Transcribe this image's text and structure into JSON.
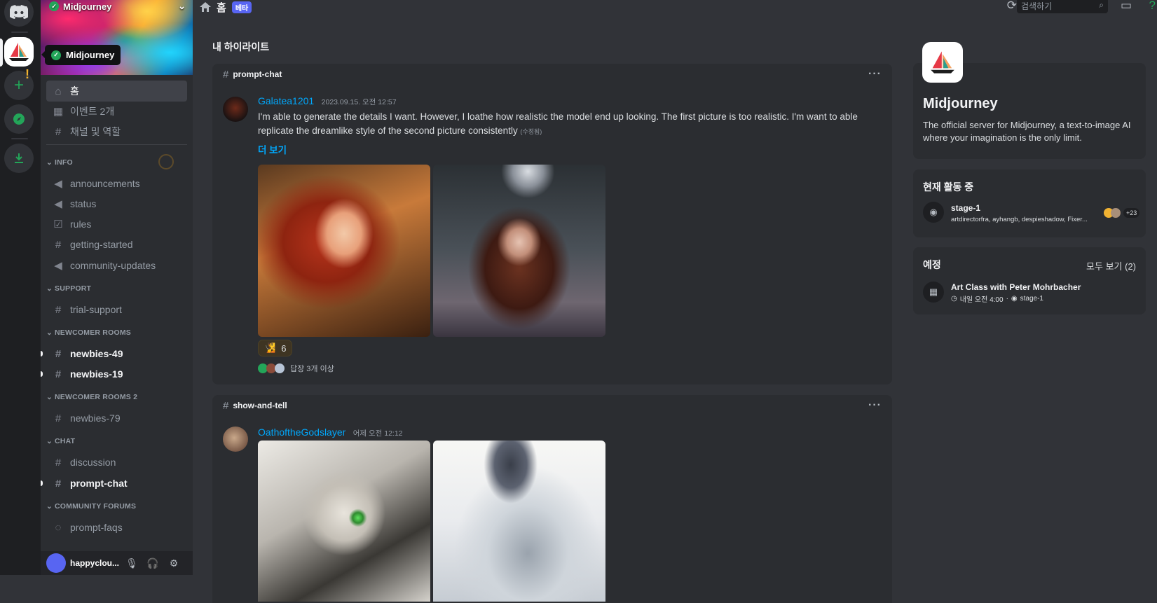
{
  "colors": {
    "accent": "#5865f2",
    "link": "#00a8fc",
    "online": "#23a559",
    "bg": "#313338"
  },
  "server": {
    "name": "Midjourney",
    "tooltip": "Midjourney"
  },
  "sidebar": {
    "top": [
      {
        "icon": "home-icon",
        "label": "홈"
      },
      {
        "icon": "calendar-icon",
        "label": "이벤트 2개"
      },
      {
        "icon": "channels-roles-icon",
        "label": "채널 및 역할"
      }
    ],
    "categories": [
      {
        "name": "INFO",
        "channels": [
          {
            "icon": "megaphone-icon",
            "label": "announcements"
          },
          {
            "icon": "megaphone-icon",
            "label": "status"
          },
          {
            "icon": "checkbox-icon",
            "label": "rules"
          },
          {
            "icon": "hash-icon",
            "label": "getting-started"
          },
          {
            "icon": "megaphone-icon",
            "label": "community-updates"
          }
        ]
      },
      {
        "name": "SUPPORT",
        "channels": [
          {
            "icon": "hash-icon",
            "label": "trial-support"
          }
        ]
      },
      {
        "name": "NEWCOMER ROOMS",
        "channels": [
          {
            "icon": "thread-hash-icon",
            "label": "newbies-49"
          },
          {
            "icon": "thread-hash-icon",
            "label": "newbies-19"
          }
        ]
      },
      {
        "name": "NEWCOMER ROOMS 2",
        "channels": [
          {
            "icon": "thread-hash-icon",
            "label": "newbies-79"
          }
        ]
      },
      {
        "name": "CHAT",
        "channels": [
          {
            "icon": "hash-icon",
            "label": "discussion"
          },
          {
            "icon": "thread-hash-icon",
            "label": "prompt-chat"
          }
        ]
      },
      {
        "name": "COMMUNITY FORUMS",
        "channels": [
          {
            "icon": "forum-icon",
            "label": "prompt-faqs"
          }
        ]
      }
    ]
  },
  "user": {
    "name": "happyclou..."
  },
  "topbar": {
    "title": "홈",
    "badge": "베타",
    "search_placeholder": "검색하기"
  },
  "feed": {
    "title": "내 하이라이트",
    "posts": [
      {
        "channel": "prompt-chat",
        "author": "Galatea1201",
        "timestamp": "2023.09.15. 오전 12:57",
        "text": "I'm able to generate the details I want. However, I loathe how realistic the model end up looking. The first picture is too realistic. I'm want to able replicate the dreamlike style of the second picture consistently",
        "edited": "(수정됨)",
        "see_more": "더 보기",
        "reaction": {
          "emoji": "🧏",
          "count": "6"
        },
        "replies": "답장 3개 이상"
      },
      {
        "channel": "show-and-tell",
        "author": "OathoftheGodslayer",
        "timestamp": "어제 오전 12:12"
      }
    ]
  },
  "right": {
    "server_name": "Midjourney",
    "server_desc": "The official server for Midjourney, a text-to-image AI where your imagination is the only limit.",
    "active_title": "현재 활동 중",
    "stage_name": "stage-1",
    "stage_users": "artdirectorfra, ayhangb, despieshadow, Fixer...",
    "stage_count": "+23",
    "events_title": "예정",
    "see_all": "모두 보기 (2)",
    "event_name": "Art Class with Peter Mohrbacher",
    "event_time": "내일 오전 4:00",
    "event_location": "stage-1"
  }
}
